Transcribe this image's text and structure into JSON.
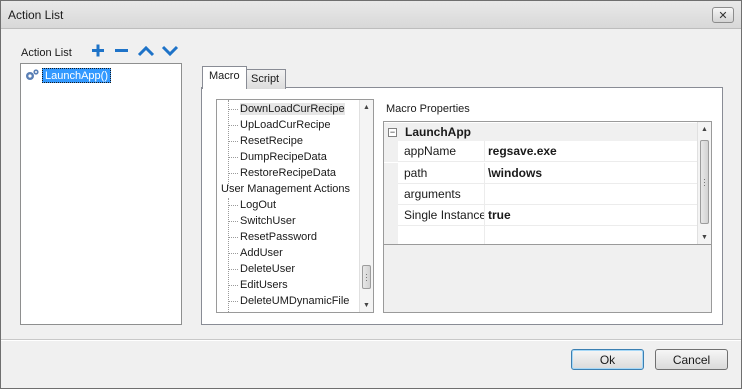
{
  "window": {
    "title": "Action List",
    "close_glyph": "✕"
  },
  "action_list": {
    "label": "Action List",
    "toolbar": [
      {
        "name": "add-icon",
        "color": "#1e73c8"
      },
      {
        "name": "remove-icon",
        "color": "#1e73c8"
      },
      {
        "name": "move-up-icon",
        "color": "#1e73c8"
      },
      {
        "name": "move-down-icon",
        "color": "#1e73c8"
      }
    ],
    "items": [
      {
        "label": "LaunchApp()",
        "icon": "gear-icon",
        "selected": true
      }
    ]
  },
  "tabs": [
    {
      "label": "Macro",
      "active": true
    },
    {
      "label": "Script",
      "active": false
    }
  ],
  "macro_tree": {
    "items": [
      {
        "label": "DownLoadCurRecipe",
        "level": 1,
        "selected": true
      },
      {
        "label": "UpLoadCurRecipe",
        "level": 1
      },
      {
        "label": "ResetRecipe",
        "level": 1
      },
      {
        "label": "DumpRecipeData",
        "level": 1
      },
      {
        "label": "RestoreRecipeData",
        "level": 1
      },
      {
        "label": "User Management Actions",
        "level": 0
      },
      {
        "label": "LogOut",
        "level": 1
      },
      {
        "label": "SwitchUser",
        "level": 1
      },
      {
        "label": "ResetPassword",
        "level": 1
      },
      {
        "label": "AddUser",
        "level": 1
      },
      {
        "label": "DeleteUser",
        "level": 1
      },
      {
        "label": "EditUsers",
        "level": 1
      },
      {
        "label": "DeleteUMDynamicFile",
        "level": 1
      }
    ]
  },
  "macro_properties": {
    "label": "Macro Properties",
    "category": {
      "name": "LaunchApp",
      "expander": "−"
    },
    "rows": [
      {
        "key": "appName",
        "value": "regsave.exe"
      },
      {
        "key": "path",
        "value": "\\windows"
      },
      {
        "key": "arguments",
        "value": ""
      },
      {
        "key": "Single Instance",
        "value": "true"
      }
    ]
  },
  "buttons": {
    "ok": "Ok",
    "cancel": "Cancel"
  },
  "colors": {
    "selection": "#3399ff",
    "toolbar_icon": "#1e73c8"
  }
}
